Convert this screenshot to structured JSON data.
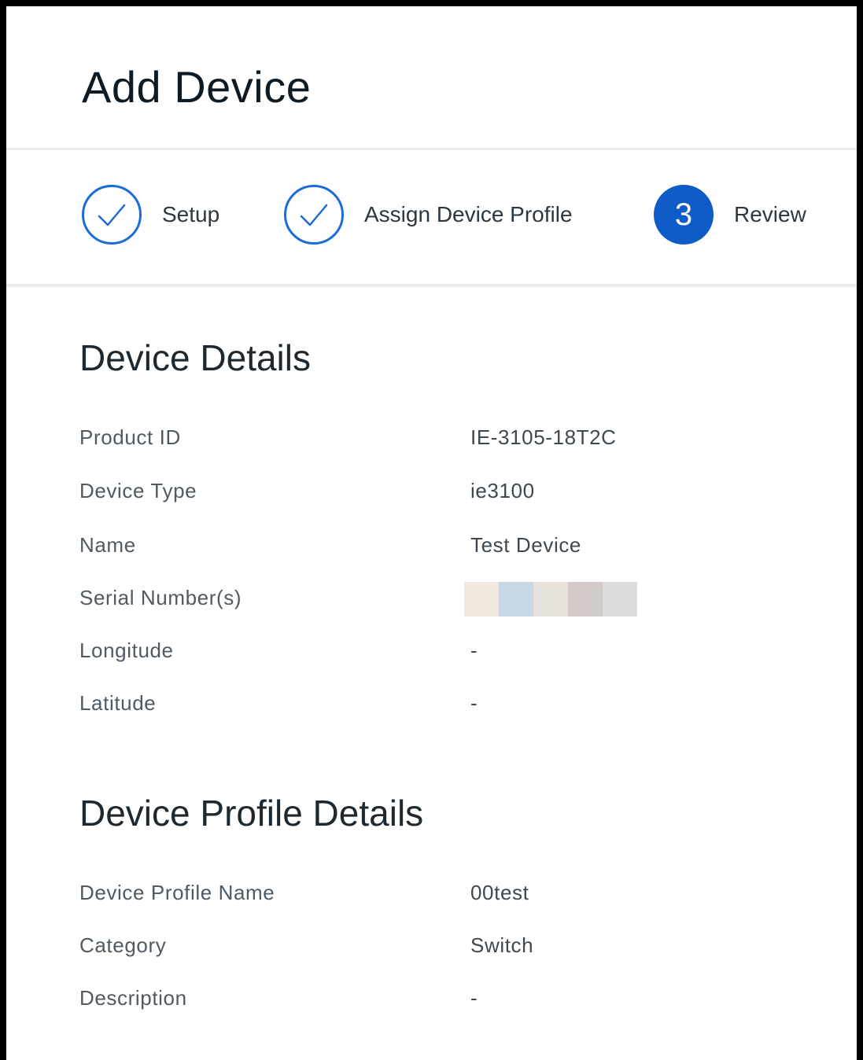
{
  "page": {
    "title": "Add Device"
  },
  "stepper": {
    "steps": [
      {
        "label": "Setup",
        "status": "complete",
        "icon": "check-icon"
      },
      {
        "label": "Assign Device Profile",
        "status": "complete",
        "icon": "check-icon"
      },
      {
        "label": "Review",
        "status": "current",
        "number": "3"
      }
    ],
    "colors": {
      "accent": "#0f5cc8",
      "complete_border": "#1d6bd6"
    }
  },
  "device_details": {
    "title": "Device Details",
    "rows": [
      {
        "label": "Product ID",
        "value": "IE-3105-18T2C"
      },
      {
        "label": "Device Type",
        "value": "ie3100"
      },
      {
        "label": "Name",
        "value": "Test Device"
      },
      {
        "label": "Serial Number(s)",
        "value": null,
        "redacted": true
      },
      {
        "label": "Longitude",
        "value": "-"
      },
      {
        "label": "Latitude",
        "value": "-"
      }
    ]
  },
  "profile_details": {
    "title": "Device Profile Details",
    "rows": [
      {
        "label": "Device Profile Name",
        "value": "00test"
      },
      {
        "label": "Category",
        "value": "Switch"
      },
      {
        "label": "Description",
        "value": "-"
      }
    ]
  }
}
